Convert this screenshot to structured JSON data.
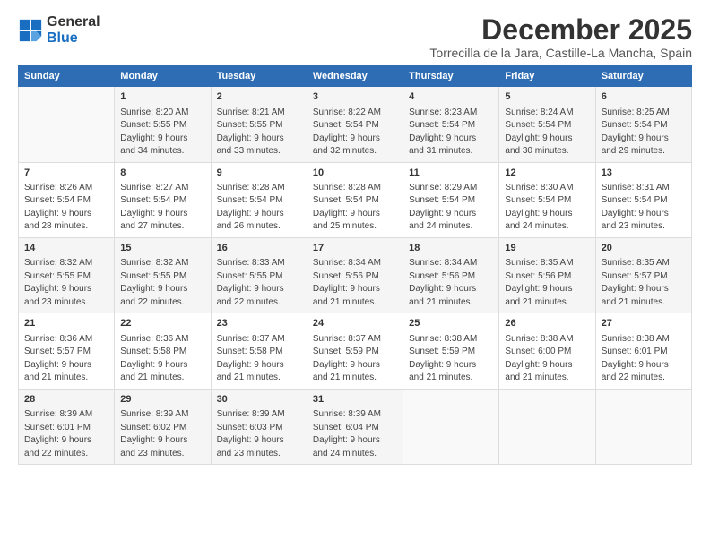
{
  "logo": {
    "line1": "General",
    "line2": "Blue"
  },
  "title": "December 2025",
  "subtitle": "Torrecilla de la Jara, Castille-La Mancha, Spain",
  "headers": [
    "Sunday",
    "Monday",
    "Tuesday",
    "Wednesday",
    "Thursday",
    "Friday",
    "Saturday"
  ],
  "weeks": [
    [
      {
        "day": "",
        "info": ""
      },
      {
        "day": "1",
        "info": "Sunrise: 8:20 AM\nSunset: 5:55 PM\nDaylight: 9 hours\nand 34 minutes."
      },
      {
        "day": "2",
        "info": "Sunrise: 8:21 AM\nSunset: 5:55 PM\nDaylight: 9 hours\nand 33 minutes."
      },
      {
        "day": "3",
        "info": "Sunrise: 8:22 AM\nSunset: 5:54 PM\nDaylight: 9 hours\nand 32 minutes."
      },
      {
        "day": "4",
        "info": "Sunrise: 8:23 AM\nSunset: 5:54 PM\nDaylight: 9 hours\nand 31 minutes."
      },
      {
        "day": "5",
        "info": "Sunrise: 8:24 AM\nSunset: 5:54 PM\nDaylight: 9 hours\nand 30 minutes."
      },
      {
        "day": "6",
        "info": "Sunrise: 8:25 AM\nSunset: 5:54 PM\nDaylight: 9 hours\nand 29 minutes."
      }
    ],
    [
      {
        "day": "7",
        "info": "Sunrise: 8:26 AM\nSunset: 5:54 PM\nDaylight: 9 hours\nand 28 minutes."
      },
      {
        "day": "8",
        "info": "Sunrise: 8:27 AM\nSunset: 5:54 PM\nDaylight: 9 hours\nand 27 minutes."
      },
      {
        "day": "9",
        "info": "Sunrise: 8:28 AM\nSunset: 5:54 PM\nDaylight: 9 hours\nand 26 minutes."
      },
      {
        "day": "10",
        "info": "Sunrise: 8:28 AM\nSunset: 5:54 PM\nDaylight: 9 hours\nand 25 minutes."
      },
      {
        "day": "11",
        "info": "Sunrise: 8:29 AM\nSunset: 5:54 PM\nDaylight: 9 hours\nand 24 minutes."
      },
      {
        "day": "12",
        "info": "Sunrise: 8:30 AM\nSunset: 5:54 PM\nDaylight: 9 hours\nand 24 minutes."
      },
      {
        "day": "13",
        "info": "Sunrise: 8:31 AM\nSunset: 5:54 PM\nDaylight: 9 hours\nand 23 minutes."
      }
    ],
    [
      {
        "day": "14",
        "info": "Sunrise: 8:32 AM\nSunset: 5:55 PM\nDaylight: 9 hours\nand 23 minutes."
      },
      {
        "day": "15",
        "info": "Sunrise: 8:32 AM\nSunset: 5:55 PM\nDaylight: 9 hours\nand 22 minutes."
      },
      {
        "day": "16",
        "info": "Sunrise: 8:33 AM\nSunset: 5:55 PM\nDaylight: 9 hours\nand 22 minutes."
      },
      {
        "day": "17",
        "info": "Sunrise: 8:34 AM\nSunset: 5:56 PM\nDaylight: 9 hours\nand 21 minutes."
      },
      {
        "day": "18",
        "info": "Sunrise: 8:34 AM\nSunset: 5:56 PM\nDaylight: 9 hours\nand 21 minutes."
      },
      {
        "day": "19",
        "info": "Sunrise: 8:35 AM\nSunset: 5:56 PM\nDaylight: 9 hours\nand 21 minutes."
      },
      {
        "day": "20",
        "info": "Sunrise: 8:35 AM\nSunset: 5:57 PM\nDaylight: 9 hours\nand 21 minutes."
      }
    ],
    [
      {
        "day": "21",
        "info": "Sunrise: 8:36 AM\nSunset: 5:57 PM\nDaylight: 9 hours\nand 21 minutes."
      },
      {
        "day": "22",
        "info": "Sunrise: 8:36 AM\nSunset: 5:58 PM\nDaylight: 9 hours\nand 21 minutes."
      },
      {
        "day": "23",
        "info": "Sunrise: 8:37 AM\nSunset: 5:58 PM\nDaylight: 9 hours\nand 21 minutes."
      },
      {
        "day": "24",
        "info": "Sunrise: 8:37 AM\nSunset: 5:59 PM\nDaylight: 9 hours\nand 21 minutes."
      },
      {
        "day": "25",
        "info": "Sunrise: 8:38 AM\nSunset: 5:59 PM\nDaylight: 9 hours\nand 21 minutes."
      },
      {
        "day": "26",
        "info": "Sunrise: 8:38 AM\nSunset: 6:00 PM\nDaylight: 9 hours\nand 21 minutes."
      },
      {
        "day": "27",
        "info": "Sunrise: 8:38 AM\nSunset: 6:01 PM\nDaylight: 9 hours\nand 22 minutes."
      }
    ],
    [
      {
        "day": "28",
        "info": "Sunrise: 8:39 AM\nSunset: 6:01 PM\nDaylight: 9 hours\nand 22 minutes."
      },
      {
        "day": "29",
        "info": "Sunrise: 8:39 AM\nSunset: 6:02 PM\nDaylight: 9 hours\nand 23 minutes."
      },
      {
        "day": "30",
        "info": "Sunrise: 8:39 AM\nSunset: 6:03 PM\nDaylight: 9 hours\nand 23 minutes."
      },
      {
        "day": "31",
        "info": "Sunrise: 8:39 AM\nSunset: 6:04 PM\nDaylight: 9 hours\nand 24 minutes."
      },
      {
        "day": "",
        "info": ""
      },
      {
        "day": "",
        "info": ""
      },
      {
        "day": "",
        "info": ""
      }
    ]
  ]
}
